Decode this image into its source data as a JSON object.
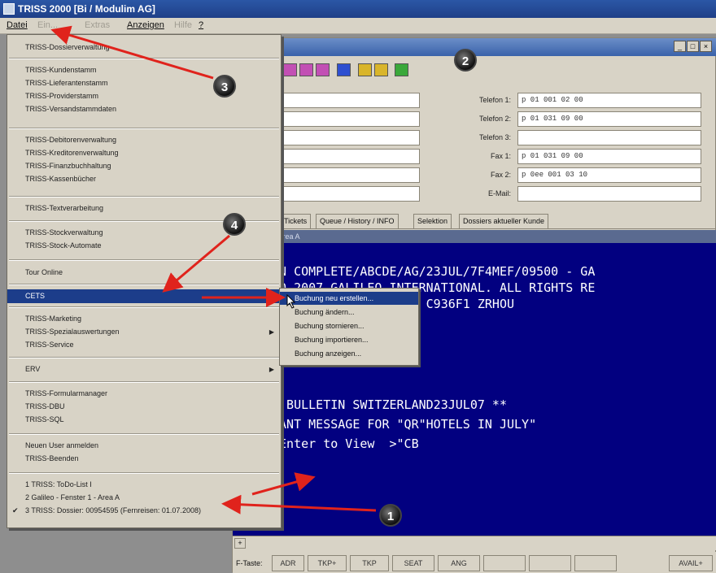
{
  "app": {
    "title": "TRISS 2000 [Bi / Modulim AG]"
  },
  "menubar": {
    "items": [
      {
        "label": "Datei",
        "enabled": true
      },
      {
        "label": "Ein...",
        "enabled": false
      },
      {
        "label": "Extras",
        "enabled": false
      },
      {
        "label": "Anzeigen",
        "enabled": true
      },
      {
        "label": "Hilfe",
        "enabled": false
      },
      {
        "label": "?",
        "enabled": true
      }
    ]
  },
  "menu": {
    "items": [
      {
        "label": "TRISS-Dossierverwaltung"
      },
      {
        "label": "TRISS-Kundenstamm"
      },
      {
        "label": "TRISS-Lieferantenstamm"
      },
      {
        "label": "TRISS-Providerstamm"
      },
      {
        "label": "TRISS-Versandstammdaten"
      },
      {
        "label": "TRISS-Debitorenverwaltung"
      },
      {
        "label": "TRISS-Kreditorenverwaltung"
      },
      {
        "label": "TRISS-Finanzbuchhaltung"
      },
      {
        "label": "TRISS-Kassenbücher"
      },
      {
        "label": "TRISS-Textverarbeitung"
      },
      {
        "label": "TRISS-Stockverwaltung"
      },
      {
        "label": "TRISS-Stock-Automate"
      },
      {
        "label": "Tour Online"
      },
      {
        "label": "CETS",
        "highlighted": true
      },
      {
        "label": "TRISS-Marketing"
      },
      {
        "label": "TRISS-Spezialauswertungen",
        "submenu": true
      },
      {
        "label": "TRISS-Service"
      },
      {
        "label": "ERV",
        "submenu": true
      },
      {
        "label": "TRISS-Formularmanager"
      },
      {
        "label": "TRISS-DBU"
      },
      {
        "label": "TRISS-SQL"
      },
      {
        "label": "Neuen User anmelden"
      },
      {
        "label": "TRISS-Beenden"
      },
      {
        "label": "1 TRISS: ToDo-List I"
      },
      {
        "label": "2 Galileo - Fenster 1 - Area A"
      },
      {
        "label": "3 TRISS: Dossier: 00954595 (Fernreisen: 01.07.2008)",
        "checked": true
      }
    ]
  },
  "submenu": {
    "items": [
      {
        "label": "Buchung neu erstellen...",
        "highlighted": true
      },
      {
        "label": "Buchung ändern..."
      },
      {
        "label": "Buchung stornieren..."
      },
      {
        "label": "Buchung importieren..."
      },
      {
        "label": "Buchung anzeigen..."
      }
    ]
  },
  "contact": {
    "fields": [
      {
        "label": "Telefon 1:",
        "value": "p 01 001 02 00"
      },
      {
        "label": "Telefon 2:",
        "value": "p 01 031 09 00"
      },
      {
        "label": "Telefon 3:",
        "value": ""
      },
      {
        "label": "Fax 1:",
        "value": "p 01 031 09 00"
      },
      {
        "label": "Fax 2:",
        "value": "p 0ee 001 03 10"
      },
      {
        "label": "E-Mail:",
        "value": ""
      }
    ]
  },
  "tabs": [
    {
      "label": "Tickets"
    },
    {
      "label": "Queue / History / INFO"
    },
    {
      "label": "Selektion"
    },
    {
      "label": "Dossiers aktueller Kunde"
    }
  ],
  "terminal": {
    "header": "Fenster 1 - Area A",
    "lines": [
      "ON COMPLETE/ABCDE/AG/23JUL/7F4MEF/09500 - GA",
      "RO 2007 GALILEO INTERNATIONAL. ALL RIGHTS RE",
      "  25 ON 21JUL07 FROM C936F1 ZRHOU",
      "",
      "",
      "",
      "",
      "C BULLETIN SWITZERLAND23JUL07 **",
      "TANT MESSAGE FOR \"QR\"HOTELS IN JULY\"",
      " Enter to View  >\"CB"
    ]
  },
  "fkeys": {
    "label": "F-Taste:",
    "keys": [
      "ADR",
      "TKP+",
      "TKP",
      "SEAT",
      "ANG",
      "",
      "",
      "",
      "AVAIL+"
    ]
  },
  "callouts": [
    "1",
    "2",
    "3",
    "4"
  ],
  "colors": {
    "terminal_bg": "#020080",
    "highlight": "#1c3d8a",
    "arrow": "#e0231c"
  }
}
